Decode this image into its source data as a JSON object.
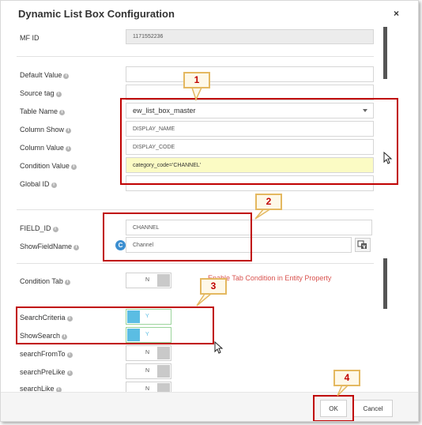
{
  "dialog": {
    "title": "Dynamic List Box Configuration",
    "close": "×"
  },
  "fields": {
    "mf_id": {
      "label": "MF ID",
      "value": "1171552236"
    },
    "default_value": {
      "label": "Default Value",
      "value": ""
    },
    "source_tag": {
      "label": "Source tag",
      "value": ""
    },
    "table_name": {
      "label": "Table Name",
      "value": "ew_list_box_master"
    },
    "column_show": {
      "label": "Column Show",
      "value": "DISPLAY_NAME"
    },
    "column_value": {
      "label": "Column Value",
      "value": "DISPLAY_CODE"
    },
    "condition_value": {
      "label": "Condition Value",
      "value": "category_code='CHANNEL'"
    },
    "global_id": {
      "label": "Global ID",
      "value": ""
    },
    "field_id": {
      "label": "FIELD_ID",
      "value": "CHANNEL"
    },
    "show_field_name": {
      "label": "ShowFieldName",
      "value": "Channel"
    }
  },
  "toggles": {
    "condition_tab": {
      "label": "Condition Tab",
      "value": "N"
    },
    "search_criteria": {
      "label": "SearchCriteria",
      "value": "Y"
    },
    "show_search": {
      "label": "ShowSearch",
      "value": "Y"
    },
    "search_from_to": {
      "label": "searchFromTo",
      "value": "N"
    },
    "search_pre_like": {
      "label": "searchPreLike",
      "value": "N"
    },
    "search_like": {
      "label": "searchLike",
      "value": "N"
    }
  },
  "condition_note": "Enable Tab Condition in Entity Property",
  "info_glyph": "i",
  "refresh_glyph": "C",
  "callouts": [
    "1",
    "2",
    "3",
    "4"
  ],
  "buttons": {
    "ok": "OK",
    "cancel": "Cancel"
  },
  "colors": {
    "highlight_red": "#c00000",
    "callout_border": "#e4b860",
    "toggle_on": "#5bbde3",
    "condition_yellow": "#fbfbc4"
  }
}
